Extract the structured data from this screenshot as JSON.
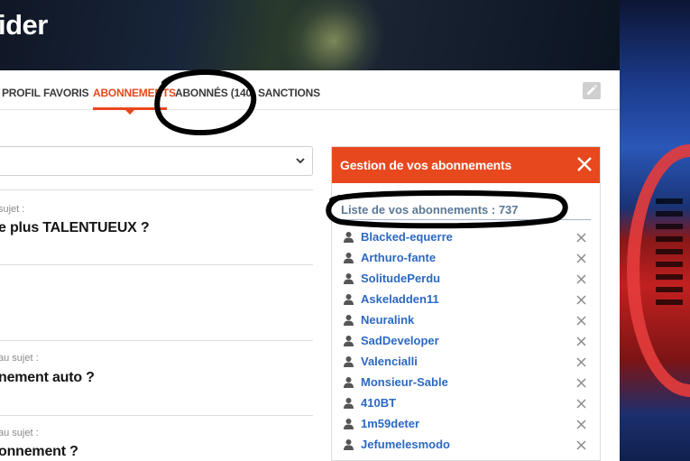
{
  "banner": {
    "title": "ider"
  },
  "tabs": [
    {
      "label": "PROFIL",
      "active": false
    },
    {
      "label": "FAVORIS",
      "active": false
    },
    {
      "label": "ABONNEMENTS",
      "active": true
    },
    {
      "label": "ABONNÉS (140)",
      "active": false
    },
    {
      "label": "SANCTIONS",
      "active": false
    }
  ],
  "edit_icon": "pencil-icon",
  "posts": [
    {
      "subtitle": "sujet :",
      "title": "e plus TALENTUEUX ?"
    },
    {
      "subtitle": "au sujet :",
      "title": "nement auto ?"
    },
    {
      "subtitle": "au sujet :",
      "title": "onnement ?"
    }
  ],
  "panel": {
    "title": "Gestion de vos abonnements",
    "list_header": "Liste de vos abonnements : 737",
    "items": [
      "Blacked-equerre",
      "Arthuro-fante",
      "SolitudePerdu",
      "Askeladden11",
      "Neuralink",
      "SadDeveloper",
      "Valencialli",
      "Monsieur-Sable",
      "410BT",
      "1m59deter",
      "Jefumelesmodo"
    ]
  },
  "colors": {
    "accent": "#e8481e",
    "link": "#2c69c2",
    "list_header": "#5a7896",
    "annotation": "#000000"
  }
}
